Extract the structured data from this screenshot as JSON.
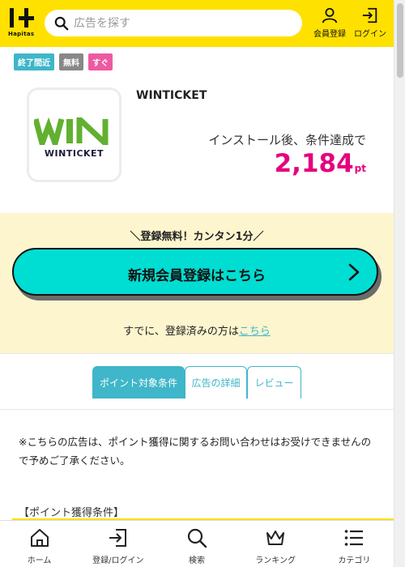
{
  "header": {
    "logo_text": "Hapitas",
    "search_placeholder": "広告を探す",
    "register_label": "会員登録",
    "login_label": "ログイン"
  },
  "badges": [
    "終了間近",
    "無料",
    "すぐ"
  ],
  "ad": {
    "logo_name": "WINTICKET",
    "logo_mark": "WIN",
    "title": "WINTICKET",
    "condition": "インストール後、条件達成で",
    "points_value": "2,184",
    "points_unit": "pt"
  },
  "register": {
    "catch": "＼登録無料！カンタン1分／",
    "button_label": "新規会員登録はこちら",
    "sub_prefix": "すでに、登録済みの方は",
    "sub_link": "こちら"
  },
  "tabs": [
    {
      "label": "ポイント対象条件",
      "active": true
    },
    {
      "label": "広告の詳細",
      "active": false
    },
    {
      "label": "レビュー",
      "active": false
    }
  ],
  "note": "※こちらの広告は、ポイント獲得に関するお問い合わせはお受けできませんので予めご了承ください。",
  "condition_heading": "【ポイント獲得条件】",
  "bottom_nav": [
    {
      "label": "ホーム",
      "icon": "home-icon"
    },
    {
      "label": "登録/ログイン",
      "icon": "login-icon"
    },
    {
      "label": "検索",
      "icon": "search-icon"
    },
    {
      "label": "ランキング",
      "icon": "crown-icon"
    },
    {
      "label": "カテゴリ",
      "icon": "list-icon"
    }
  ],
  "colors": {
    "brand_yellow": "#FFE100",
    "accent_teal": "#3FB6C9",
    "points_pink": "#E5007E",
    "register_button": "#00DDD2",
    "register_bg": "#FDF5CE",
    "win_green": "#62B030"
  }
}
